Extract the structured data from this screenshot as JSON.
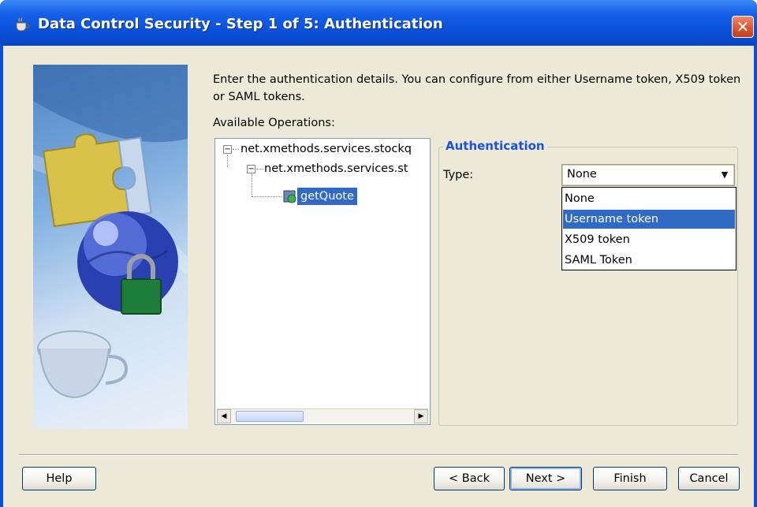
{
  "window": {
    "title": "Data Control Security - Step 1 of 5: Authentication",
    "close_glyph": "✕"
  },
  "intro_text": "Enter the authentication details. You can configure from either Username token, X509 token or SAML tokens.",
  "available_operations_label": "Available Operations:",
  "tree": {
    "root_label": "net.xmethods.services.stockq",
    "child_label": "net.xmethods.services.st",
    "operation_label": "getQuote",
    "toggle_glyph": "−"
  },
  "authentication": {
    "legend": "Authentication",
    "type_label": "Type:",
    "type_value": "None",
    "options": [
      "None",
      "Username token",
      "X509 token",
      "SAML Token"
    ],
    "highlighted_option": "Username token"
  },
  "buttons": {
    "help": "Help",
    "back": "< Back",
    "next": "Next >",
    "finish": "Finish",
    "cancel": "Cancel"
  },
  "colors": {
    "titlebar": "#0a50d8",
    "selection": "#316ac5",
    "legend": "#1c52d8",
    "dialog_bg": "#ece9d8"
  },
  "icons": {
    "app": "coffee-cup-icon",
    "close": "close-icon",
    "operation": "operation-icon",
    "combo": "chevron-down-icon"
  }
}
